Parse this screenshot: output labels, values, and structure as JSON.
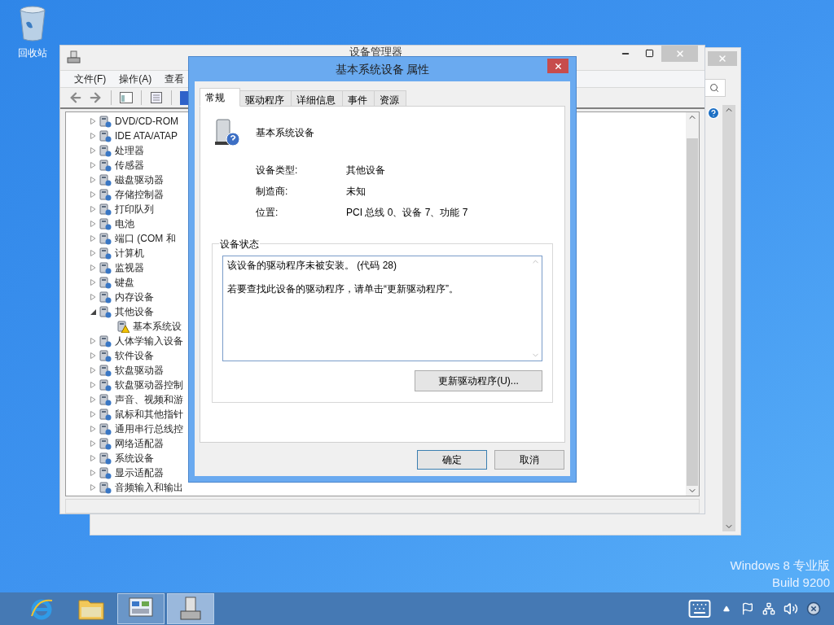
{
  "desktop": {
    "icons": [
      {
        "label": "回收站"
      }
    ],
    "os_text": [
      "Windows 8 专业版",
      "Build 9200"
    ]
  },
  "device_manager": {
    "title": "设备管理器",
    "menu": [
      "文件(F)",
      "操作(A)",
      "查看"
    ],
    "tree": [
      {
        "label": "DVD/CD-ROM",
        "expanded": false
      },
      {
        "label": "IDE ATA/ATAP",
        "expanded": false
      },
      {
        "label": "处理器",
        "expanded": false
      },
      {
        "label": "传感器",
        "expanded": false
      },
      {
        "label": "磁盘驱动器",
        "expanded": false
      },
      {
        "label": "存储控制器",
        "expanded": false
      },
      {
        "label": "打印队列",
        "expanded": false
      },
      {
        "label": "电池",
        "expanded": false
      },
      {
        "label": "端口 (COM 和",
        "expanded": false
      },
      {
        "label": "计算机",
        "expanded": false
      },
      {
        "label": "监视器",
        "expanded": false
      },
      {
        "label": "键盘",
        "expanded": false
      },
      {
        "label": "内存设备",
        "expanded": false
      },
      {
        "label": "其他设备",
        "expanded": true,
        "children": [
          {
            "label": "基本系统设",
            "warning": true
          }
        ]
      },
      {
        "label": "人体学输入设备",
        "expanded": false
      },
      {
        "label": "软件设备",
        "expanded": false
      },
      {
        "label": "软盘驱动器",
        "expanded": false
      },
      {
        "label": "软盘驱动器控制",
        "expanded": false
      },
      {
        "label": "声音、视频和游",
        "expanded": false
      },
      {
        "label": "鼠标和其他指针",
        "expanded": false
      },
      {
        "label": "通用串行总线控",
        "expanded": false
      },
      {
        "label": "网络适配器",
        "expanded": false
      },
      {
        "label": "系统设备",
        "expanded": false
      },
      {
        "label": "显示适配器",
        "expanded": false
      },
      {
        "label": "音频输入和输出",
        "expanded": false
      }
    ]
  },
  "dialog": {
    "title": "基本系统设备 属性",
    "tabs": [
      {
        "label": "常规",
        "selected": true
      },
      {
        "label": "驱动程序",
        "selected": false
      },
      {
        "label": "详细信息",
        "selected": false
      },
      {
        "label": "事件",
        "selected": false
      },
      {
        "label": "资源",
        "selected": false
      }
    ],
    "device_name": "基本系统设备",
    "properties": [
      {
        "label": "设备类型:",
        "value": "其他设备"
      },
      {
        "label": "制造商:",
        "value": "未知"
      },
      {
        "label": "位置:",
        "value": "PCI 总线 0、设备 7、功能 7"
      }
    ],
    "status_group": "设备状态",
    "status_lines": [
      "该设备的驱动程序未被安装。 (代码 28)",
      "若要查找此设备的驱动程序，请单击“更新驱动程序”。"
    ],
    "update_button": "更新驱动程序(U)...",
    "buttons": [
      {
        "label": "确定",
        "default": true
      },
      {
        "label": "取消",
        "default": false
      }
    ]
  },
  "taskbar": {
    "apps": [
      {
        "kind": "browser",
        "open": false,
        "selected": false
      },
      {
        "kind": "folder",
        "open": false,
        "selected": false
      },
      {
        "kind": "console",
        "open": true,
        "selected": false
      },
      {
        "kind": "device",
        "open": true,
        "selected": true
      }
    ]
  }
}
